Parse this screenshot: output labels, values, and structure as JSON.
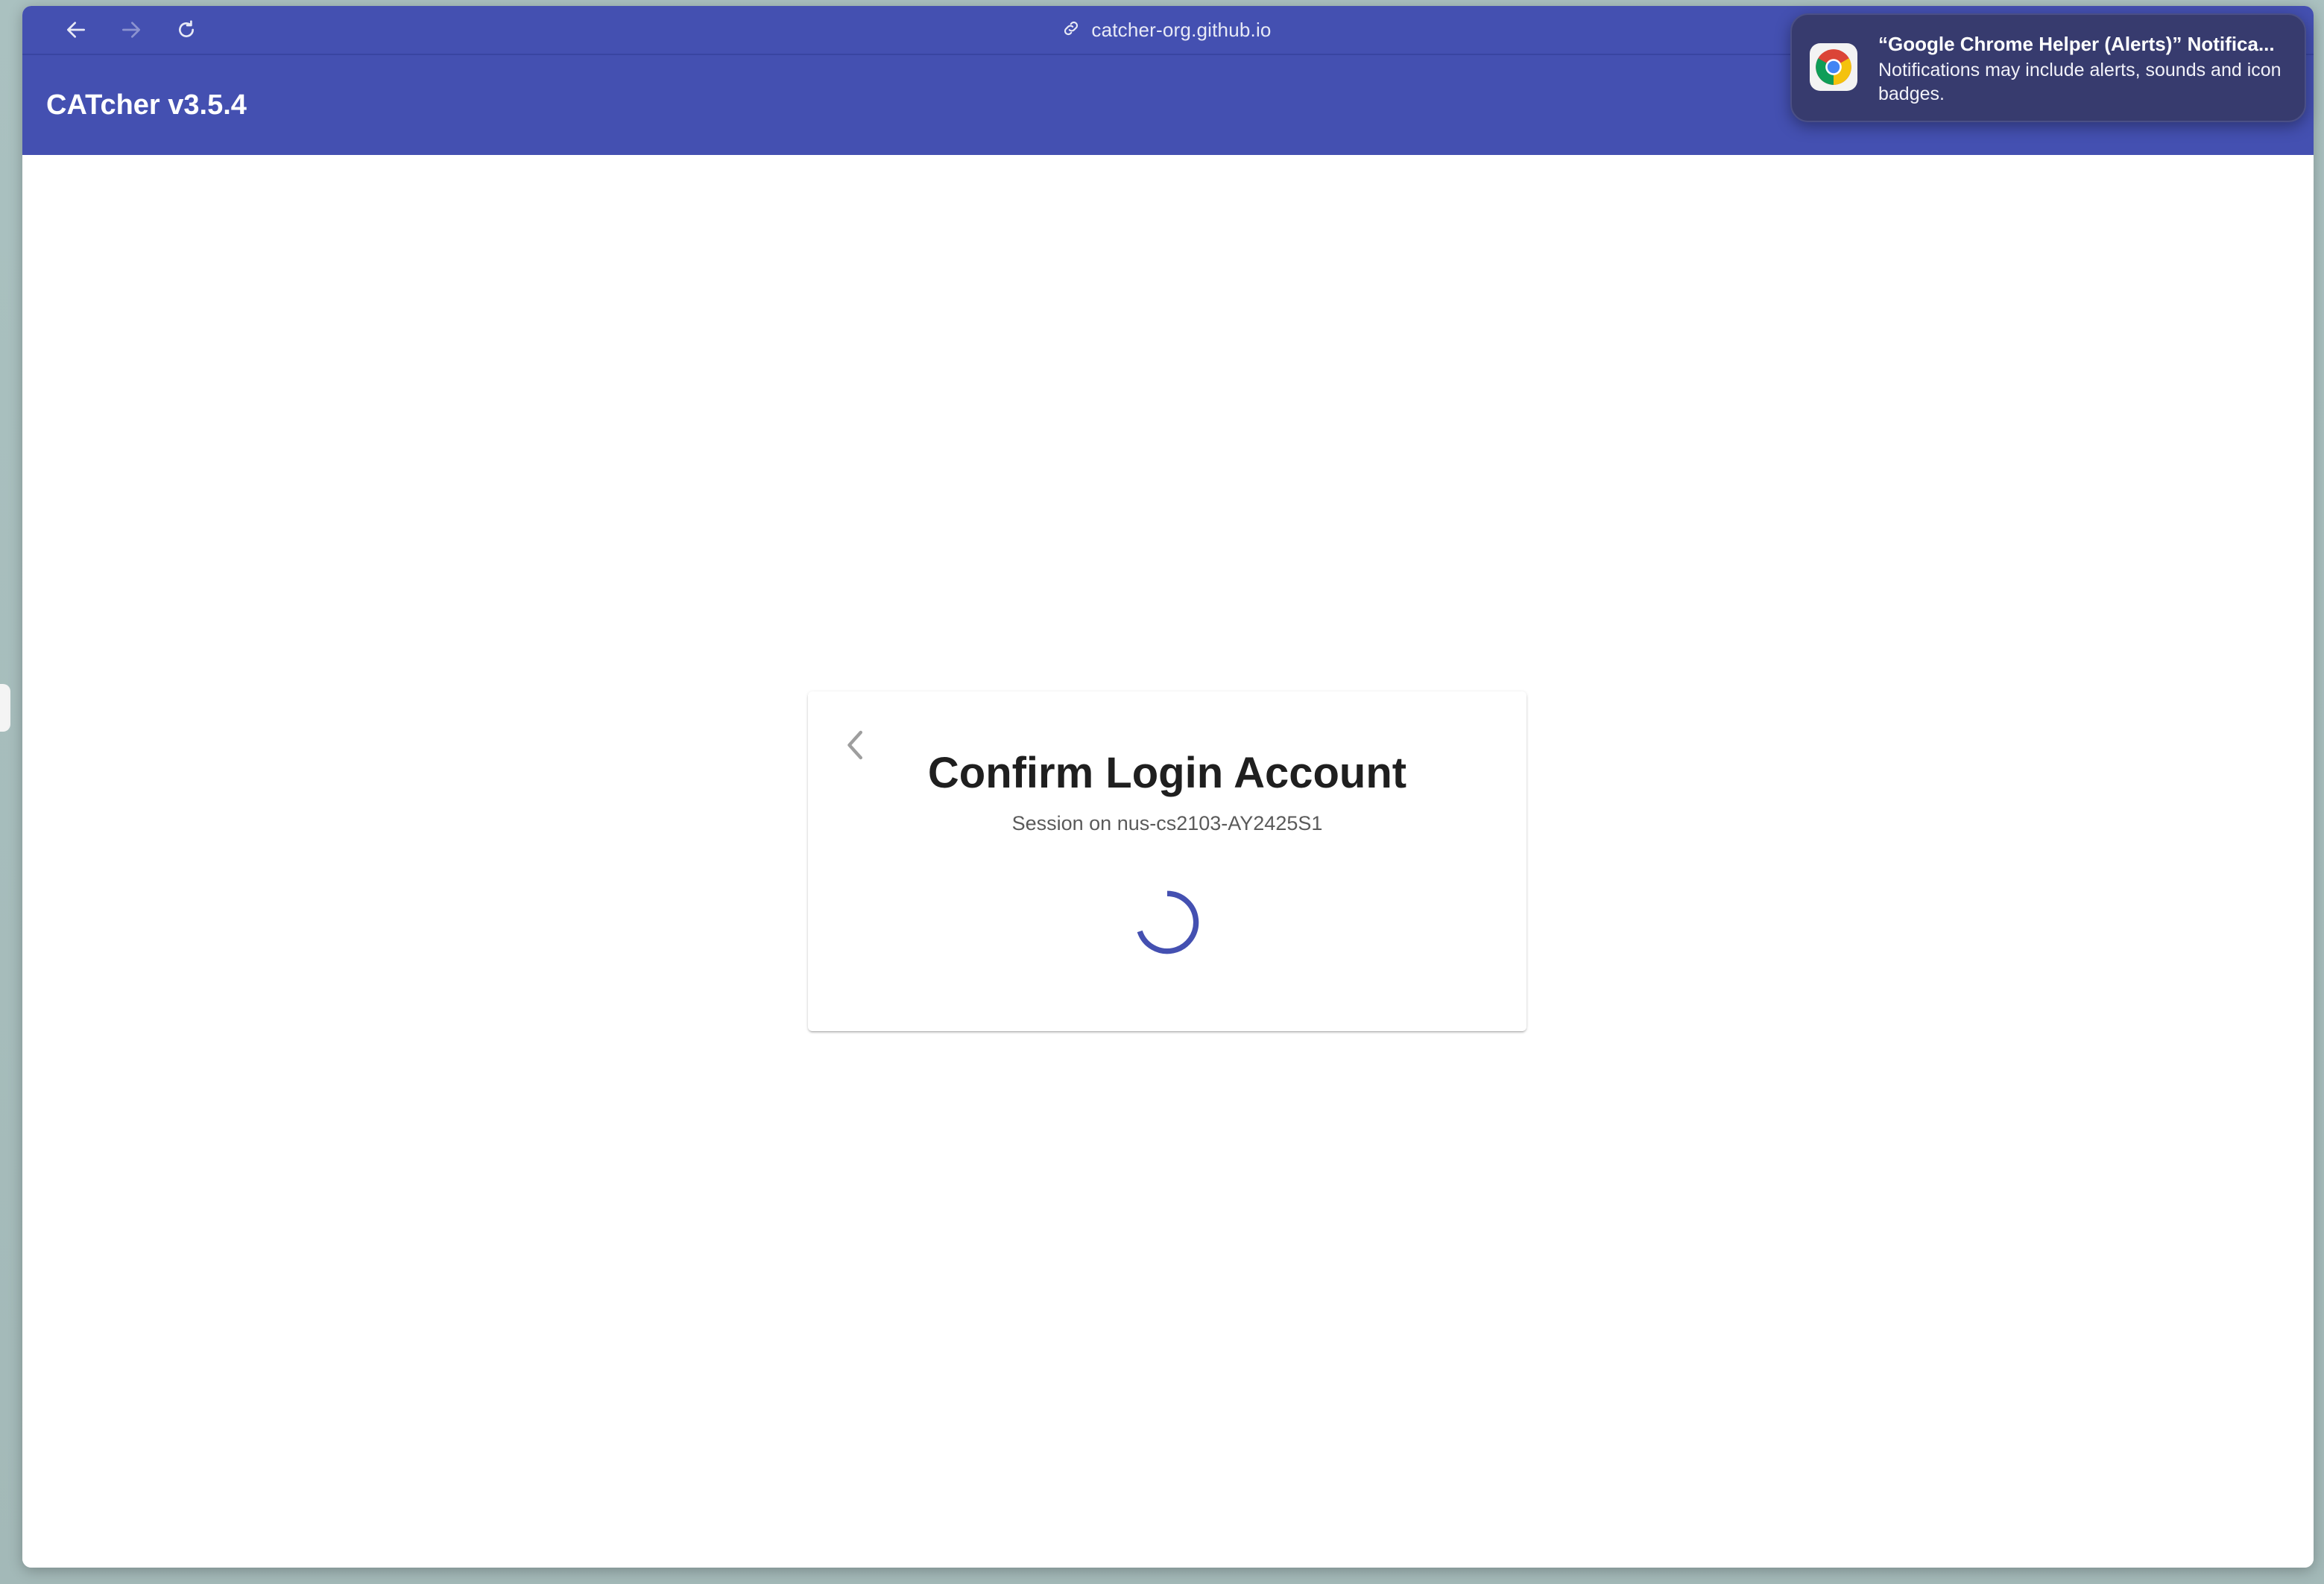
{
  "browser": {
    "url": "catcher-org.github.io"
  },
  "app": {
    "title": "CATcher v3.5.4"
  },
  "login_card": {
    "title": "Confirm Login Account",
    "subtitle": "Session on nus-cs2103-AY2425S1"
  },
  "notification": {
    "title": "“Google Chrome Helper (Alerts)” Notifica...",
    "body": "Notifications may include alerts, sounds and icon badges."
  },
  "colors": {
    "primary": "#4450b1",
    "notification_bg": "#373b6e"
  }
}
